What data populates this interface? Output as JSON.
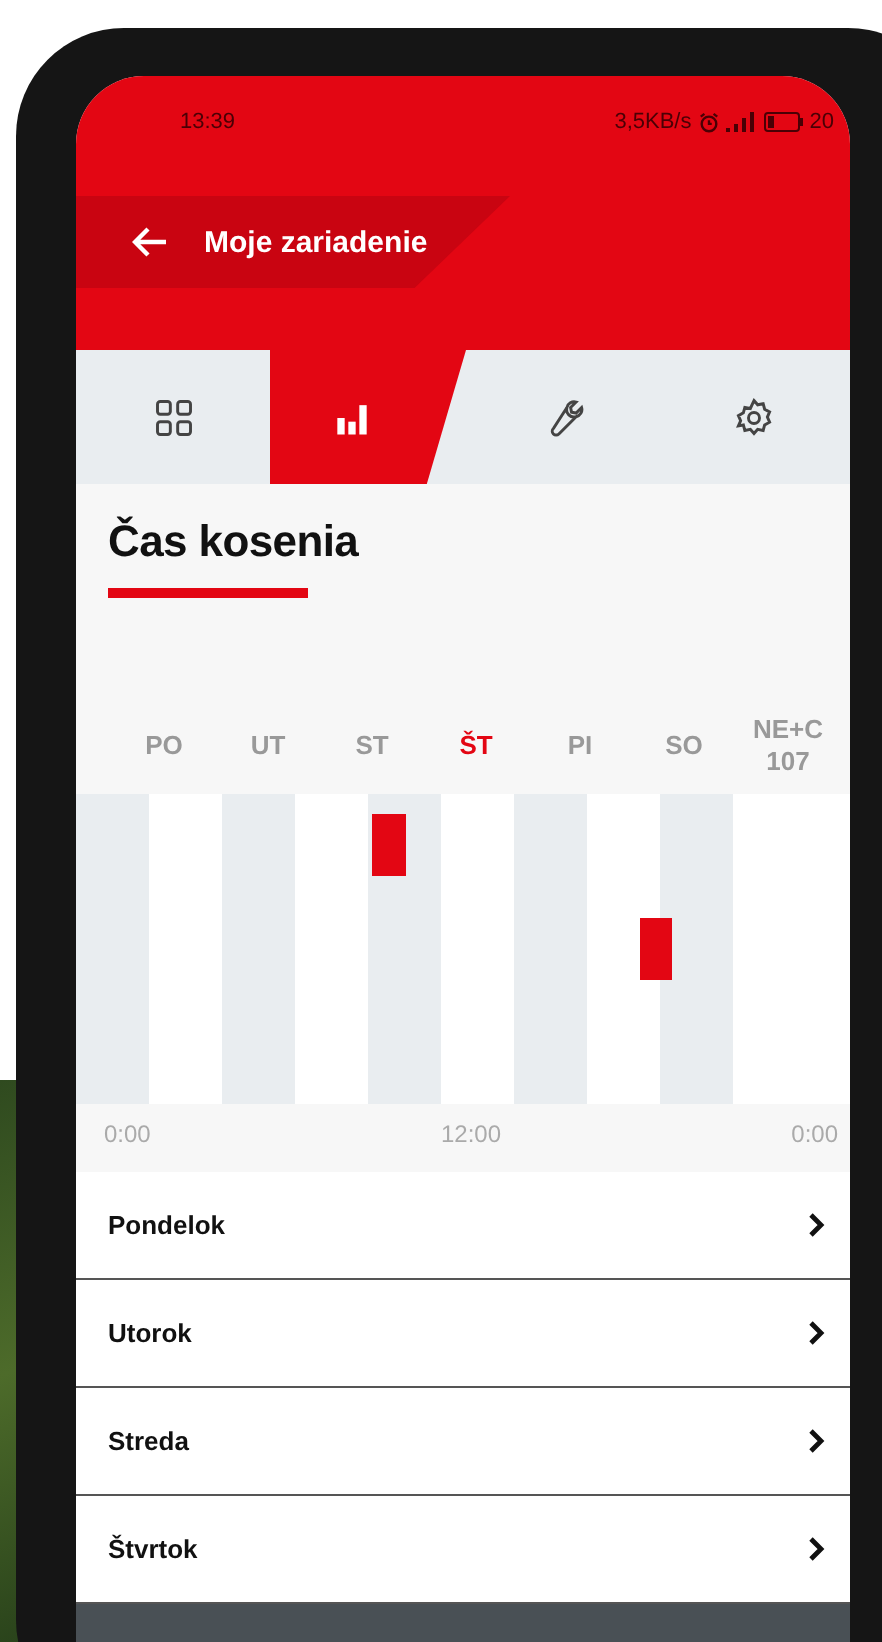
{
  "status_bar": {
    "time": "13:39",
    "network_speed": "3,5KB/s",
    "battery": "20"
  },
  "header": {
    "title": "Moje zariadenie"
  },
  "tabs": [
    {
      "kind": "grid",
      "selected": false
    },
    {
      "kind": "chart",
      "selected": true
    },
    {
      "kind": "wrench",
      "selected": false
    },
    {
      "kind": "gear",
      "selected": false
    }
  ],
  "section_title": "Čas kosenia",
  "schedule": {
    "days": [
      {
        "label": "PO",
        "selected": false
      },
      {
        "label": "UT",
        "selected": false
      },
      {
        "label": "ST",
        "selected": false
      },
      {
        "label": "ŠT",
        "selected": true
      },
      {
        "label": "PI",
        "selected": false
      },
      {
        "label": "SO",
        "selected": false
      },
      {
        "label": "NE+C 107",
        "selected": false
      }
    ],
    "time_labels": [
      "0:00",
      "12:00",
      "0:00"
    ]
  },
  "days_list": [
    {
      "label": "Pondelok"
    },
    {
      "label": "Utorok"
    },
    {
      "label": "Streda"
    },
    {
      "label": "Štvrtok"
    }
  ]
}
